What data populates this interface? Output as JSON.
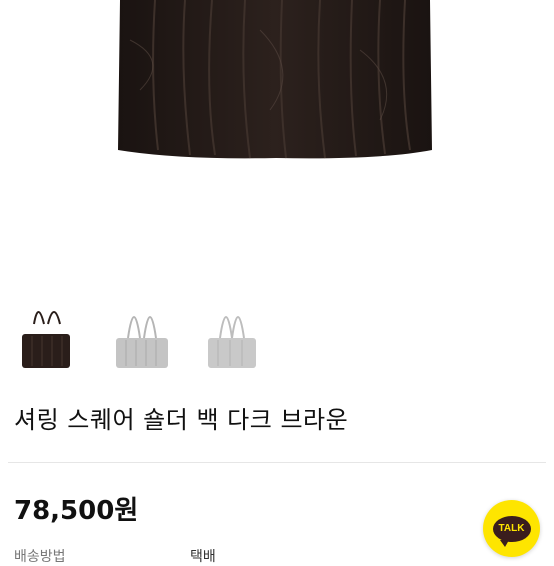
{
  "product": {
    "title": "셔링 스퀘어 숄더 백 다크 브라운",
    "price": "78,500원",
    "shipping_label": "배송방법",
    "shipping_value": "택배"
  },
  "thumbnails": [
    {
      "name": "dark-brown",
      "color": "#2a1e1a",
      "selected": true
    },
    {
      "name": "gray",
      "color": "#c4c4c4",
      "selected": false
    },
    {
      "name": "light-gray",
      "color": "#c9c9c9",
      "selected": false
    }
  ],
  "chat_button": {
    "label": "TALK",
    "color": "#FEE500"
  },
  "colors": {
    "bag": "#231a17",
    "text": "#111111"
  }
}
